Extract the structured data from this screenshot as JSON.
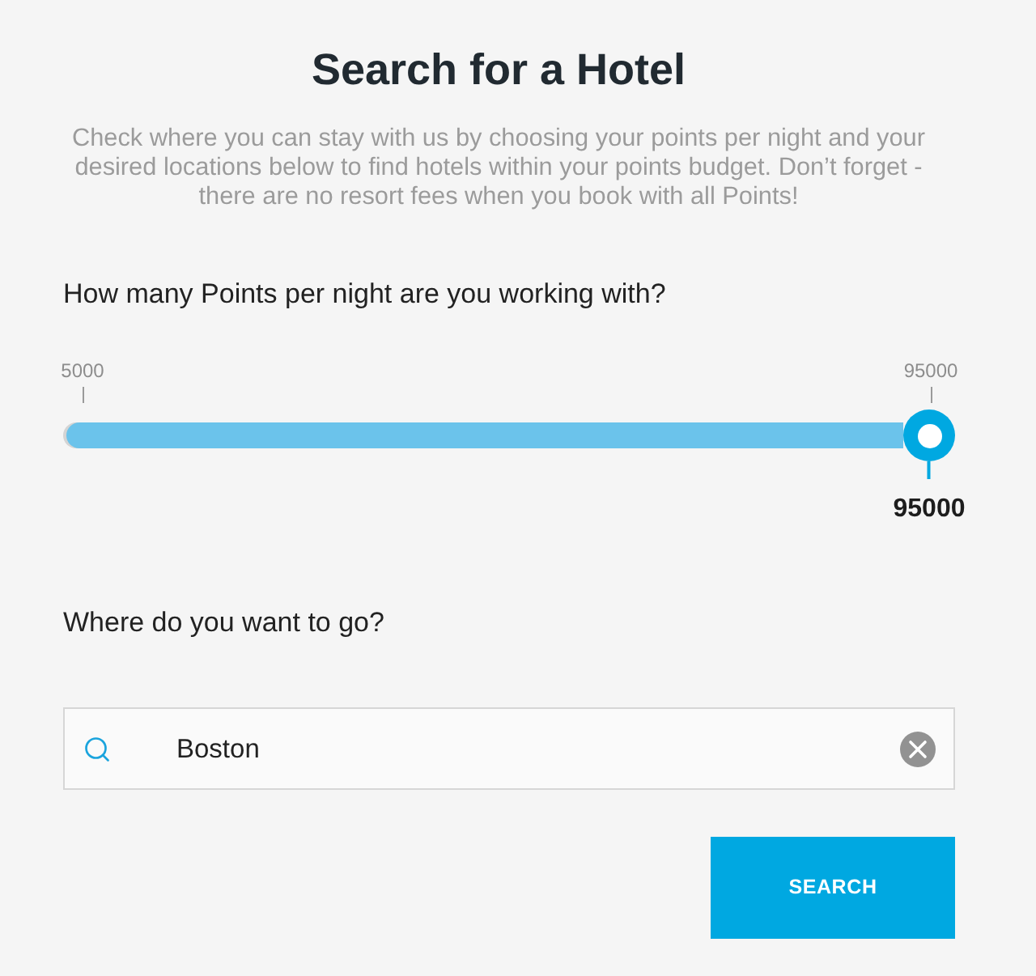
{
  "title": "Search for a Hotel",
  "intro": "Check where you can stay with us by choosing your points per night and your desired locations below to find hotels within your points budget. Don’t forget - there are no resort fees when you book with all Points!",
  "points": {
    "question": "How many Points per night are you working with?",
    "min_label": "5000",
    "max_label": "95000",
    "level": 1,
    "reading": "95000"
  },
  "destination": {
    "question": "Where do you want to go?",
    "value": "Boston"
  },
  "search_button": {
    "label": "SEARCH"
  }
}
